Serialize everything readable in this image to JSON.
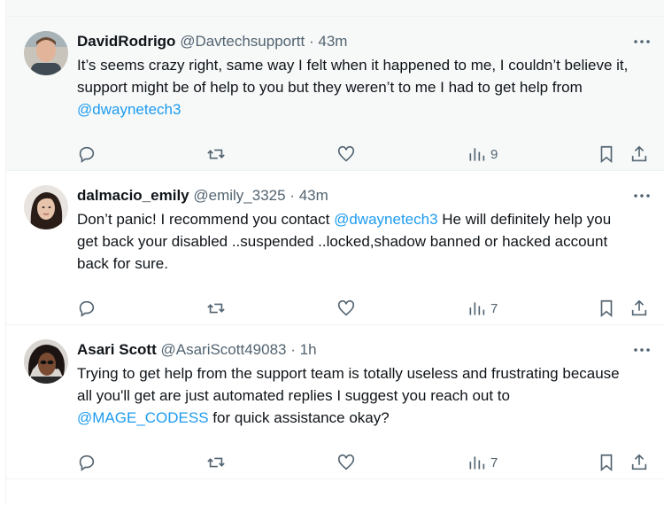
{
  "tweets": [
    {
      "name": "DavidRodrigo",
      "handle": "@Davtechsupportt",
      "separator": "·",
      "time": "43m",
      "text_before": "It’s seems crazy right, same way I felt when it happened to me, I couldn’t believe it, support might be of help to you but they weren’t to me I had to get help from ",
      "mention": "@dwaynetech3",
      "text_after": "",
      "views": "9"
    },
    {
      "name": "dalmacio_emily",
      "handle": "@emily_3325",
      "separator": "·",
      "time": "43m",
      "text_before": "Don’t panic! I recommend you contact ",
      "mention": "@dwaynetech3",
      "text_after": " He will definitely help you get back your disabled ..suspended ..locked,shadow banned or hacked account back for sure.",
      "views": "7"
    },
    {
      "name": "Asari Scott",
      "handle": "@AsariScott49083",
      "separator": "·",
      "time": "1h",
      "text_before": "Trying to get help from the support team is totally useless and frustrating because all you'll get are just automated replies I suggest you reach out to ",
      "mention": "@MAGE_CODESS",
      "text_after": " for quick assistance okay?",
      "views": "7"
    }
  ],
  "icons": {
    "more": "more-horizontal-icon",
    "reply": "reply-icon",
    "repost": "repost-icon",
    "like": "like-icon",
    "views": "views-icon",
    "bookmark": "bookmark-icon",
    "share": "share-icon"
  },
  "colors": {
    "text": "#0f1419",
    "muted": "#536471",
    "link": "#1d9bf0",
    "hover_bg": "#f7f9f9",
    "border": "#eff3f4"
  }
}
